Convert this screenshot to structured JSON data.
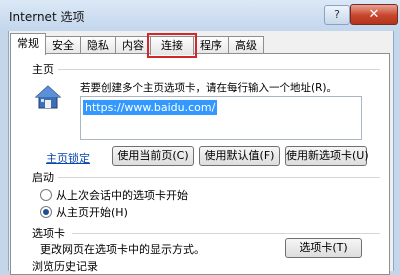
{
  "window": {
    "title": "Internet 选项",
    "help_label": "?",
    "close_label": "✕"
  },
  "tabs": [
    {
      "label": "常规"
    },
    {
      "label": "安全"
    },
    {
      "label": "隐私"
    },
    {
      "label": "内容"
    },
    {
      "label": "连接"
    },
    {
      "label": "程序"
    },
    {
      "label": "高级"
    }
  ],
  "homepage": {
    "section_label": "主页",
    "instruction": "若要创建多个主页选项卡，请在每行输入一个地址(R)。",
    "url": "https://www.baidu.com/",
    "lock_link": "主页锁定",
    "use_current": "使用当前页(C)",
    "use_default": "使用默认值(F)",
    "use_new_tab": "使用新选项卡(U)"
  },
  "startup": {
    "section_label": "启动",
    "option_last_session": "从上次会话中的选项卡开始",
    "option_home": "从主页开始(H)",
    "selected": "从主页开始(H)"
  },
  "tabs_section": {
    "section_label": "选项卡",
    "description": "更改网页在选项卡中的显示方式。",
    "button": "选项卡(T)"
  },
  "history": {
    "section_label": "浏览历史记录"
  },
  "icons": {
    "home": "home-icon"
  }
}
